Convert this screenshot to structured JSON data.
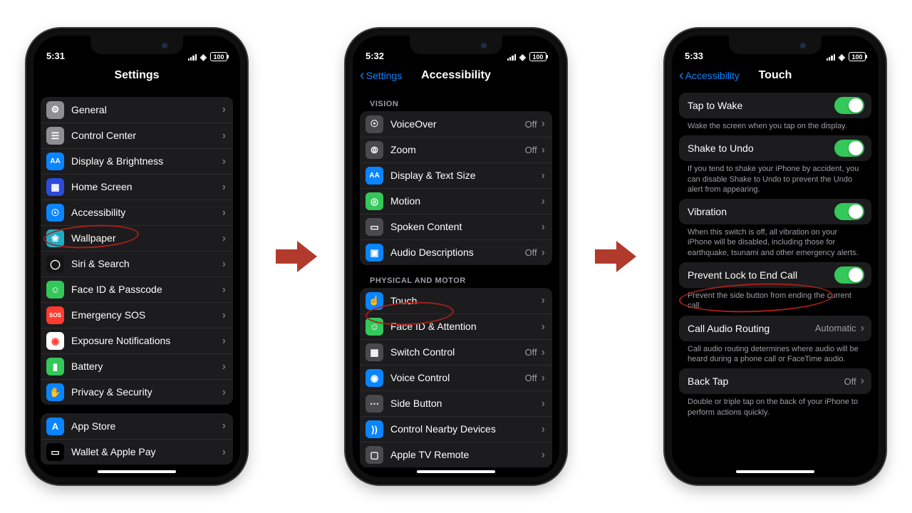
{
  "status": {
    "time1": "5:31",
    "time2": "5:32",
    "time3": "5:33",
    "battery": "100"
  },
  "p1": {
    "title": "Settings",
    "g1": [
      "General",
      "Control Center",
      "Display & Brightness",
      "Home Screen",
      "Accessibility",
      "Wallpaper",
      "Siri & Search",
      "Face ID & Passcode",
      "Emergency SOS",
      "Exposure Notifications",
      "Battery",
      "Privacy & Security"
    ],
    "g2": [
      "App Store",
      "Wallet & Apple Pay"
    ]
  },
  "p2": {
    "back": "Settings",
    "title": "Accessibility",
    "hdr1": "VISION",
    "vision": [
      {
        "label": "VoiceOver",
        "value": "Off"
      },
      {
        "label": "Zoom",
        "value": "Off"
      },
      {
        "label": "Display & Text Size",
        "value": ""
      },
      {
        "label": "Motion",
        "value": ""
      },
      {
        "label": "Spoken Content",
        "value": ""
      },
      {
        "label": "Audio Descriptions",
        "value": "Off"
      }
    ],
    "hdr2": "PHYSICAL AND MOTOR",
    "motor": [
      {
        "label": "Touch",
        "value": ""
      },
      {
        "label": "Face ID & Attention",
        "value": ""
      },
      {
        "label": "Switch Control",
        "value": "Off"
      },
      {
        "label": "Voice Control",
        "value": "Off"
      },
      {
        "label": "Side Button",
        "value": ""
      },
      {
        "label": "Control Nearby Devices",
        "value": ""
      },
      {
        "label": "Apple TV Remote",
        "value": ""
      }
    ]
  },
  "p3": {
    "back": "Accessibility",
    "title": "Touch",
    "rows": {
      "tap": "Tap to Wake",
      "tap_foot": "Wake the screen when you tap on the display.",
      "shake": "Shake to Undo",
      "shake_foot": "If you tend to shake your iPhone by accident, you can disable Shake to Undo to prevent the Undo alert from appearing.",
      "vib": "Vibration",
      "vib_foot": "When this switch is off, all vibration on your iPhone will be disabled, including those for earthquake, tsunami and other emergency alerts.",
      "lock": "Prevent Lock to End Call",
      "lock_foot": "Prevent the side button from ending the current call.",
      "call": "Call Audio Routing",
      "call_val": "Automatic",
      "call_foot": "Call audio routing determines where audio will be heard during a phone call or FaceTime audio.",
      "bt": "Back Tap",
      "bt_val": "Off",
      "bt_foot": "Double or triple tap on the back of your iPhone to perform actions quickly."
    }
  },
  "icons": {
    "p1": [
      {
        "bg": "#8e8e93",
        "g": "⚙"
      },
      {
        "bg": "#8e8e93",
        "g": "☰"
      },
      {
        "bg": "#0a84ff",
        "g": "AA",
        "fs": "10px"
      },
      {
        "bg": "#2b4bd8",
        "g": "▦"
      },
      {
        "bg": "#0a84ff",
        "g": "☉"
      },
      {
        "bg": "#20adc4",
        "g": "❀"
      },
      {
        "bg": "#141414",
        "g": "◯"
      },
      {
        "bg": "#34c759",
        "g": "☺"
      },
      {
        "bg": "#ff3b30",
        "g": "SOS",
        "fs": "8px"
      },
      {
        "bg": "#fff",
        "g": "◉",
        "fg": "#ff3b30"
      },
      {
        "bg": "#34c759",
        "g": "▮"
      },
      {
        "bg": "#0a84ff",
        "g": "✋"
      },
      {
        "bg": "#0a84ff",
        "g": "A"
      },
      {
        "bg": "#000",
        "g": "▭"
      }
    ],
    "p2v": [
      {
        "bg": "#4a4a4e",
        "g": "☉"
      },
      {
        "bg": "#4a4a4e",
        "g": "⦾"
      },
      {
        "bg": "#0a84ff",
        "g": "AA",
        "fs": "10px"
      },
      {
        "bg": "#34c759",
        "g": "◎"
      },
      {
        "bg": "#4a4a4e",
        "g": "▭"
      },
      {
        "bg": "#0a84ff",
        "g": "▣"
      }
    ],
    "p2m": [
      {
        "bg": "#0a84ff",
        "g": "☝"
      },
      {
        "bg": "#34c759",
        "g": "☺"
      },
      {
        "bg": "#4a4a4e",
        "g": "▦"
      },
      {
        "bg": "#0a84ff",
        "g": "◉"
      },
      {
        "bg": "#4a4a4e",
        "g": "⋯"
      },
      {
        "bg": "#0a84ff",
        "g": "))"
      },
      {
        "bg": "#4a4a4e",
        "g": "▢"
      }
    ]
  }
}
